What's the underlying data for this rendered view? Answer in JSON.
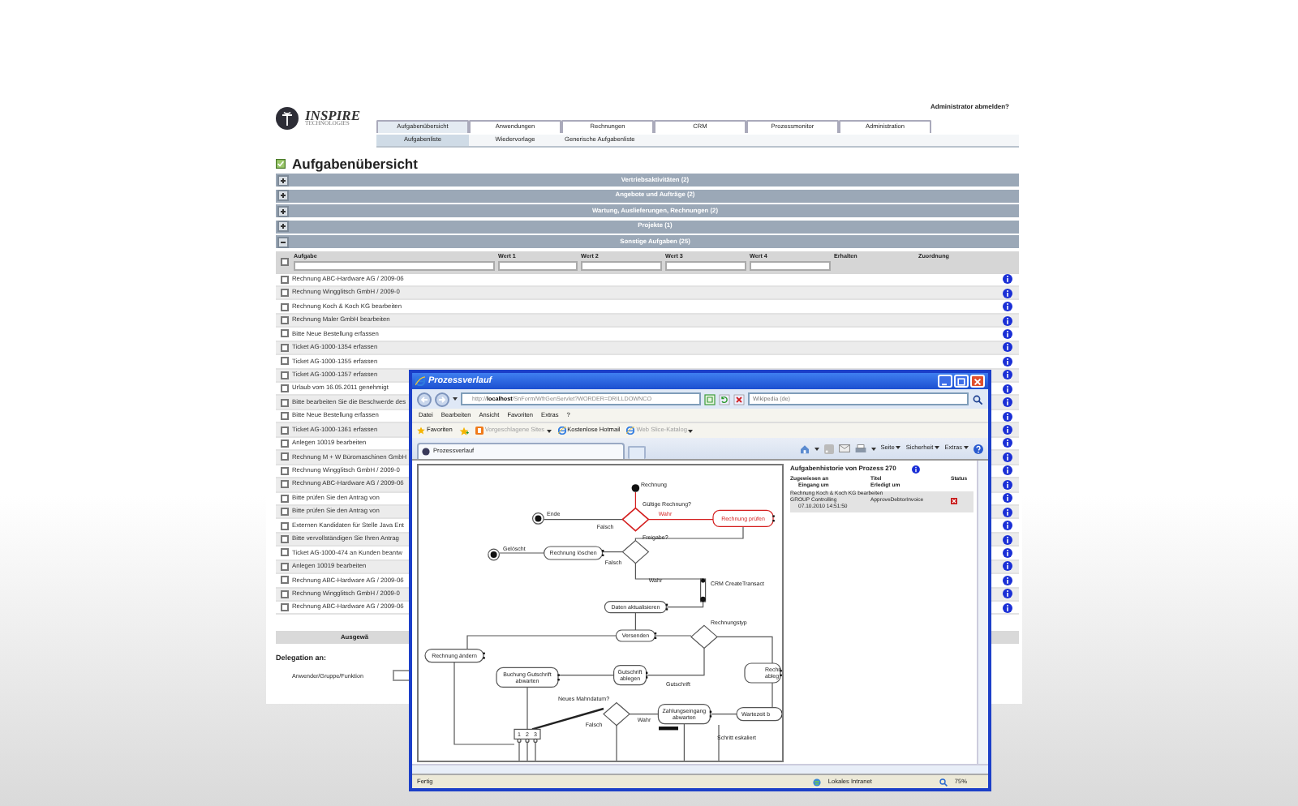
{
  "header": {
    "logo": {
      "name": "INSPIRE",
      "tagline": "TECHNOLOGIES"
    },
    "logout_link": "Administrator abmelden?"
  },
  "tabs": [
    {
      "label": "Aufgabenübersicht",
      "selected": true
    },
    {
      "label": "Anwendungen",
      "selected": false
    },
    {
      "label": "Rechnungen",
      "selected": false
    },
    {
      "label": "CRM",
      "selected": false
    },
    {
      "label": "Prozessmonitor",
      "selected": false
    },
    {
      "label": "Administration",
      "selected": false
    }
  ],
  "subtabs": [
    {
      "label": "Aufgabenliste",
      "selected": true
    },
    {
      "label": "Wiedervorlage",
      "selected": false
    },
    {
      "label": "Generische Aufgabenliste",
      "selected": false
    }
  ],
  "page_title": "Aufgabenübersicht",
  "groups": [
    {
      "label": "Vertriebsaktivitäten (2)",
      "expanded": false
    },
    {
      "label": "Angebote und Aufträge (2)",
      "expanded": false
    },
    {
      "label": "Wartung, Auslieferungen, Rechnungen (2)",
      "expanded": false
    },
    {
      "label": "Projekte (1)",
      "expanded": false
    },
    {
      "label": "Sonstige Aufgaben (25)",
      "expanded": true
    }
  ],
  "table": {
    "select_all_checked": false,
    "columns": [
      "Aufgabe",
      "Wert 1",
      "Wert 2",
      "Wert 3",
      "Wert 4",
      "Erhalten",
      "Zuordnung"
    ],
    "rows": [
      {
        "task": "Rechnung ABC-Hardware AG / 2009-06",
        "checked": false
      },
      {
        "task": "Rechnung Wingglitsch GmbH / 2009-0",
        "checked": false
      },
      {
        "task": "Rechnung Koch & Koch KG bearbeiten",
        "checked": false
      },
      {
        "task": "Rechnung Maler GmbH bearbeiten",
        "checked": false
      },
      {
        "task": "Bitte Neue Bestellung erfassen",
        "checked": false
      },
      {
        "task": "Ticket AG-1000-1354 erfassen",
        "checked": false
      },
      {
        "task": "Ticket AG-1000-1355 erfassen",
        "checked": false
      },
      {
        "task": "Ticket AG-1000-1357 erfassen",
        "checked": false
      },
      {
        "task": "Urlaub vom 16.05.2011 genehmigt",
        "checked": false
      },
      {
        "task": "Bitte bearbeiten Sie die Beschwerde des",
        "checked": false
      },
      {
        "task": "Bitte Neue Bestellung erfassen",
        "checked": false
      },
      {
        "task": "Ticket AG-1000-1361 erfassen",
        "checked": false
      },
      {
        "task": "Anlegen 10019 bearbeiten",
        "checked": false
      },
      {
        "task": "Rechnung M + W Büromaschinen GmbH",
        "checked": false
      },
      {
        "task": "Rechnung Wingglitsch GmbH / 2009-0",
        "checked": false
      },
      {
        "task": "Rechnung ABC-Hardware AG / 2009-06",
        "checked": false
      },
      {
        "task": "Bitte prüfen Sie den Antrag von",
        "checked": false
      },
      {
        "task": "Bitte prüfen Sie den Antrag von",
        "checked": false
      },
      {
        "task": "Externen Kandidaten für Stelle Java Ent",
        "checked": false
      },
      {
        "task": "Bitte vervollständigen Sie Ihren Antrag",
        "checked": false
      },
      {
        "task": "Ticket AG-1000-474 an Kunden beantw",
        "checked": false
      },
      {
        "task": "Anlegen 10019 bearbeiten",
        "checked": false
      },
      {
        "task": "Rechnung ABC-Hardware AG / 2009-06",
        "checked": false
      },
      {
        "task": "Rechnung Wingglitsch GmbH / 2009-0",
        "checked": false
      },
      {
        "task": "Rechnung ABC-Hardware AG / 2009-06",
        "checked": false
      }
    ]
  },
  "section_bar": "Ausgewä",
  "delegation": {
    "title": "Delegation an:",
    "field_label": "Anwender/Gruppe/Funktion"
  },
  "browser": {
    "title": "Prozessverlauf",
    "address": "http://**localhost**/SnForm/WfrGenServlet?WORDER=DRILLDOWNCO",
    "search_placeholder": "Wikipedia (de)",
    "menu": [
      "Datei",
      "Bearbeiten",
      "Ansicht",
      "Favoriten",
      "Extras",
      "?"
    ],
    "favorites_button": "Favoriten",
    "favorites": [
      {
        "label": "Vorgeschlagene Sites",
        "disabled": true
      },
      {
        "label": "Kostenlose Hotmail",
        "disabled": false
      },
      {
        "label": "Web Slice-Katalog",
        "disabled": true
      }
    ],
    "tab": "Prozessverlauf",
    "commands": [
      "Seite",
      "Sicherheit",
      "Extras"
    ],
    "status": {
      "text": "Fertig",
      "zone": "Lokales Intranet",
      "zoom": "75%"
    }
  },
  "diagram": {
    "nodes": [
      {
        "kind": "start",
        "lines": [
          "Rechnung"
        ],
        "active": false
      },
      {
        "kind": "decision",
        "lines": [
          "Gültige Rechnung?"
        ],
        "active": true
      },
      {
        "kind": "edge-label",
        "lines": [
          "Wahr"
        ],
        "active": true
      },
      {
        "kind": "action",
        "lines": [
          "Rechnung prüfen"
        ],
        "active": true
      },
      {
        "kind": "end",
        "lines": [
          "Ende"
        ],
        "active": false
      },
      {
        "kind": "edge-label",
        "lines": [
          "Falsch"
        ],
        "active": false
      },
      {
        "kind": "decision",
        "lines": [
          "Freigabe?"
        ],
        "active": false
      },
      {
        "kind": "action",
        "lines": [
          "Rechnung löschen"
        ],
        "active": false
      },
      {
        "kind": "end",
        "lines": [
          "Gelöscht"
        ],
        "active": false
      },
      {
        "kind": "edge-label",
        "lines": [
          "Falsch"
        ],
        "active": false
      },
      {
        "kind": "edge-label",
        "lines": [
          "Wahr"
        ],
        "active": false
      },
      {
        "kind": "service",
        "lines": [
          "CRM CreateTransact"
        ],
        "active": false
      },
      {
        "kind": "action",
        "lines": [
          "Daten aktualisieren"
        ],
        "active": false
      },
      {
        "kind": "action",
        "lines": [
          "Versenden"
        ],
        "active": false
      },
      {
        "kind": "decision",
        "lines": [
          "Rechnungstyp"
        ],
        "active": false
      },
      {
        "kind": "action",
        "lines": [
          "Rechnung ändern"
        ],
        "active": false
      },
      {
        "kind": "action",
        "lines": [
          "Buchung Gutschrift",
          "abwarten"
        ],
        "active": false
      },
      {
        "kind": "action",
        "lines": [
          "Gutschrift",
          "ablegen"
        ],
        "active": false
      },
      {
        "kind": "edge-label",
        "lines": [
          "Gutschrift"
        ],
        "active": false
      },
      {
        "kind": "action",
        "lines": [
          "Rechn",
          "ableg"
        ],
        "active": false
      },
      {
        "kind": "decision",
        "lines": [
          "Neues Mahndatum?"
        ],
        "active": false
      },
      {
        "kind": "edge-label",
        "lines": [
          "Falsch"
        ],
        "active": false
      },
      {
        "kind": "edge-label",
        "lines": [
          "Wahr"
        ],
        "active": false
      },
      {
        "kind": "action",
        "lines": [
          "Zahlungseingang",
          "abwarten"
        ],
        "active": false
      },
      {
        "kind": "action",
        "lines": [
          "Wartezeit b"
        ],
        "active": false
      },
      {
        "kind": "edge-label",
        "lines": [
          "Schritt eskaliert"
        ],
        "active": false
      },
      {
        "kind": "split",
        "lines": [
          "1",
          "2",
          "3"
        ],
        "active": false
      }
    ]
  },
  "history": {
    "title": "Aufgabenhistorie von Prozess 270",
    "columns": [
      "Zugewiesen an",
      "Titel",
      "Status"
    ],
    "subcolumns": [
      "Eingang um",
      "Erledigt um"
    ],
    "entries": [
      {
        "task": "Rechnung Koch & Koch KG bearbeiten",
        "assignee": "GROUP Controlling",
        "title": "ApproveDebtorInvoice",
        "received": "07.10.2010 14:51:50",
        "rejected": true
      }
    ]
  }
}
